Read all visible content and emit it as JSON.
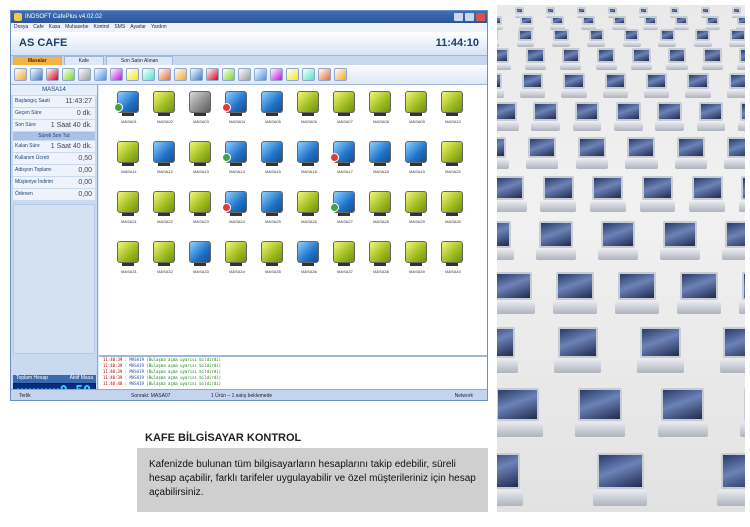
{
  "app": {
    "window_title": "INDSOFT CafePlus v4.02.02",
    "menu": [
      "Dosya",
      "Cafe",
      "Kasa",
      "Muhasebe",
      "Kontrol",
      "SMS",
      "Ayarlar",
      "Yardım"
    ],
    "cafe_name": "AS CAFE",
    "clock": "11:44:10",
    "tabs": [
      {
        "label": "Masalar",
        "active": true
      },
      {
        "label": "Kafe",
        "active": false
      },
      {
        "label": "Son Satın Alınan",
        "active": false
      }
    ],
    "toolbar_icons": [
      "open-icon",
      "print-icon",
      "user-icon",
      "lock-icon",
      "lock-icon",
      "arrow-icon",
      "person-icon",
      "arrow-right-icon",
      "cancel-icon",
      "screen-icon",
      "warning-icon",
      "monitor-icon",
      "restart-icon",
      "stop-icon",
      "tea-icon",
      "cafe-icon",
      "chart-icon",
      "tool-icon",
      "edit-icon",
      "power-icon",
      "settings-icon"
    ],
    "side_panel": {
      "table_name": "MASA14",
      "rows": [
        {
          "label": "Başlangıç Saati",
          "value": "11:43:27"
        },
        {
          "label": "Geçen Süre",
          "value": "0 dk."
        },
        {
          "label": "Son Süre",
          "value": "1 Saat 40 dk."
        }
      ],
      "section_title": "Süreli Son Tut",
      "rows2": [
        {
          "label": "Kalan Süre",
          "value": "1 Saat 40 dk."
        },
        {
          "label": "Kullanım Ücreti",
          "value": "0,50"
        },
        {
          "label": "Adisyon Toplamı",
          "value": "0,00"
        },
        {
          "label": "Müşteriye İndirim",
          "value": "0,00"
        },
        {
          "label": "Ödenen",
          "value": "0,00"
        }
      ],
      "summary_left": "Toplam Hesap",
      "summary_right": "Aktif Masa",
      "digital_value": "0,50"
    },
    "computers": [
      [
        "MASA01",
        "MASA02",
        "MASA03",
        "MASA04",
        "MASA05",
        "MASA06",
        "MASA07",
        "MASA08",
        "MASA09",
        "MASA10"
      ],
      [
        "MASA11",
        "MASA12",
        "MASA13",
        "MASA14",
        "MASA15",
        "MASA16",
        "MASA17",
        "MASA18",
        "MASA19",
        "MASA20"
      ],
      [
        "MASA21",
        "MASA22",
        "MASA23",
        "MASA24",
        "MASA25",
        "MASA26",
        "MASA27",
        "MASA28",
        "MASA29",
        "MASA30"
      ],
      [
        "MASA31",
        "MASA32",
        "MASA33",
        "MASA34",
        "MASA35",
        "MASA36",
        "MASA37",
        "MASA38",
        "MASA39",
        "MASA40"
      ]
    ],
    "computer_states": [
      [
        "blue",
        "green",
        "gray",
        "blue",
        "blue",
        "green",
        "green",
        "green",
        "green",
        "green"
      ],
      [
        "green",
        "blue",
        "green",
        "blue",
        "blue",
        "blue",
        "blue",
        "blue",
        "blue",
        "green"
      ],
      [
        "green",
        "green",
        "green",
        "blue",
        "blue",
        "green",
        "blue",
        "green",
        "green",
        "green"
      ],
      [
        "green",
        "green",
        "blue",
        "green",
        "green",
        "blue",
        "green",
        "green",
        "green",
        "green"
      ]
    ],
    "log_lines": [
      {
        "time": "11:40:39",
        "table": "MASA19",
        "msg": "(Bulaşma açma uyarısı bildirdi)"
      },
      {
        "time": "11:40:39",
        "table": "MASA19",
        "msg": "(Bulaşma açma uyarısı bildirdi)"
      },
      {
        "time": "11:40:39",
        "table": "MASA19",
        "msg": "(Bulaşma açma uyarısı bildirdi)"
      },
      {
        "time": "11:40:39",
        "table": "MASA19",
        "msg": "(Bulaşma açma uyarısı bildirdi)"
      },
      {
        "time": "11:40:40",
        "table": "MASA19",
        "msg": "(Bulaşma açma uyarısı bildirdi)"
      }
    ],
    "status": {
      "left": "Terlik",
      "mid": "Sonraki: MASA07",
      "mid2": "1 Ürün – 1 satış beklemede",
      "right": "Network"
    }
  },
  "caption": {
    "title": "KAFE BİLGİSAYAR KONTROL",
    "text": "Kafenizde bulunan tüm bilgisayarların hesaplarını takip edebilir, süreli hesap açabilir, farklı tarifeler uygulayabilir ve özel müşterileriniz için hesap açabilirsiniz."
  },
  "colors": {
    "accent": "#f5b342",
    "brand_blue": "#1d3f73",
    "digital_bg": "#0a2f7a",
    "digital_fg": "#38d1ff"
  }
}
